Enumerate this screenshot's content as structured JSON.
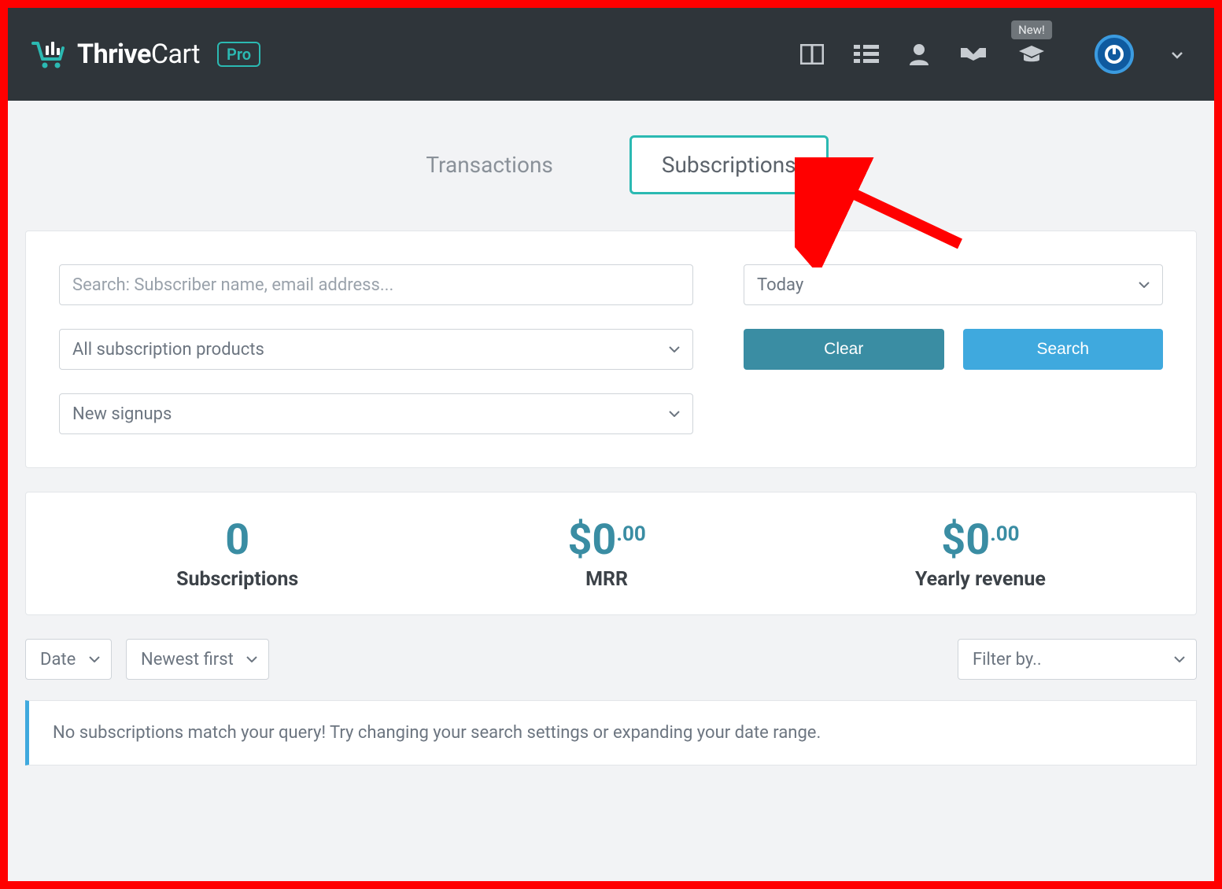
{
  "brand": {
    "name1": "Thrive",
    "name2": "Cart",
    "pro": "Pro"
  },
  "topbar": {
    "new_badge": "New!"
  },
  "tabs": {
    "transactions": "Transactions",
    "subscriptions": "Subscriptions"
  },
  "filters": {
    "search_placeholder": "Search: Subscriber name, email address...",
    "products": "All subscription products",
    "signups": "New signups",
    "daterange": "Today",
    "clear": "Clear",
    "search": "Search"
  },
  "stats": {
    "subs_value": "0",
    "subs_label": "Subscriptions",
    "mrr_value": "$0",
    "mrr_cents": ".00",
    "mrr_label": "MRR",
    "yr_value": "$0",
    "yr_cents": ".00",
    "yr_label": "Yearly revenue"
  },
  "sort": {
    "field": "Date",
    "direction": "Newest first",
    "filter_by": "Filter by.."
  },
  "empty_msg": "No subscriptions match your query! Try changing your search settings or expanding your date range."
}
